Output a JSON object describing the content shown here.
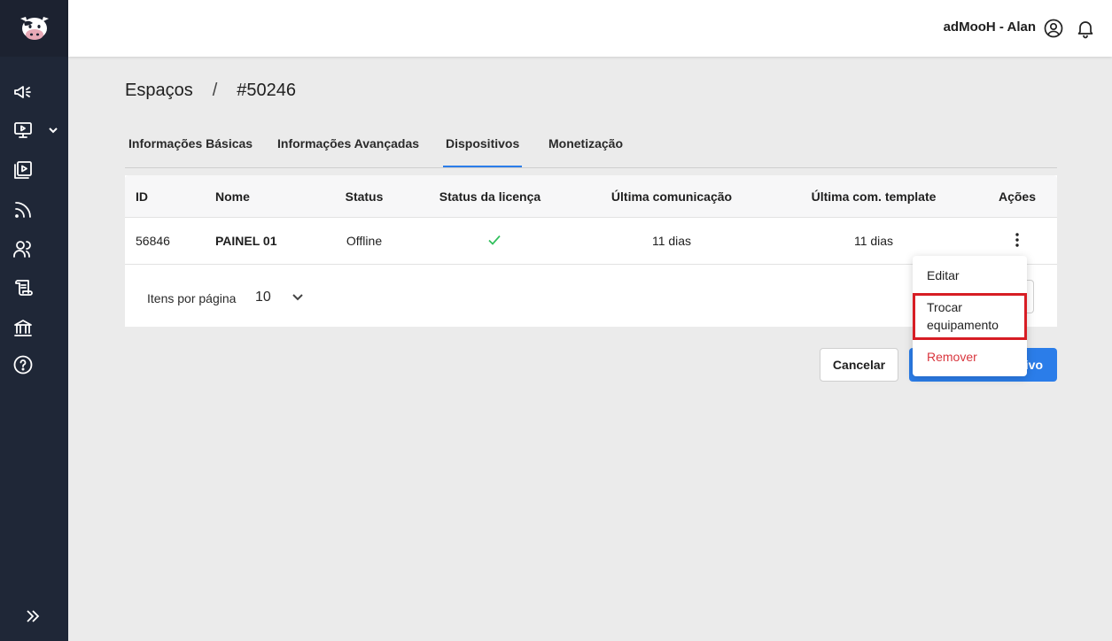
{
  "header": {
    "account": "adMooH - Alan"
  },
  "breadcrumb": {
    "parent": "Espaços",
    "separator": "/",
    "current": "#50246"
  },
  "tabs": [
    {
      "label": "Informações Básicas"
    },
    {
      "label": "Informações Avançadas"
    },
    {
      "label": "Dispositivos",
      "active": true
    },
    {
      "label": "Monetização"
    }
  ],
  "table": {
    "columns": [
      "ID",
      "Nome",
      "Status",
      "Status da licença",
      "Última comunicação",
      "Última com. template",
      "Ações"
    ],
    "rows": [
      {
        "id": "56846",
        "name": "PAINEL 01",
        "status": "Offline",
        "license_ok": true,
        "last_comm": "11 dias",
        "last_template": "11 dias"
      }
    ]
  },
  "pagination": {
    "label": "Itens por página",
    "value": "10"
  },
  "actions_menu": {
    "items": [
      "Editar",
      "Trocar equipamento",
      "Remover"
    ],
    "highlighted": "Trocar equipamento"
  },
  "buttons": {
    "cancel": "Cancelar",
    "primary_visible_text": "ivo"
  },
  "colors": {
    "sidebar": "#1f2737",
    "accent": "#2b7de9",
    "success": "#2fbf5b",
    "danger": "#d9363e",
    "highlight_border": "#d71d24"
  },
  "icons": {
    "sidebar": [
      "megaphone-icon",
      "monitor-play-icon",
      "media-library-icon",
      "rss-icon",
      "users-icon",
      "scroll-icon",
      "bank-icon",
      "help-icon"
    ],
    "header": [
      "user-circle-icon",
      "bell-icon"
    ]
  }
}
